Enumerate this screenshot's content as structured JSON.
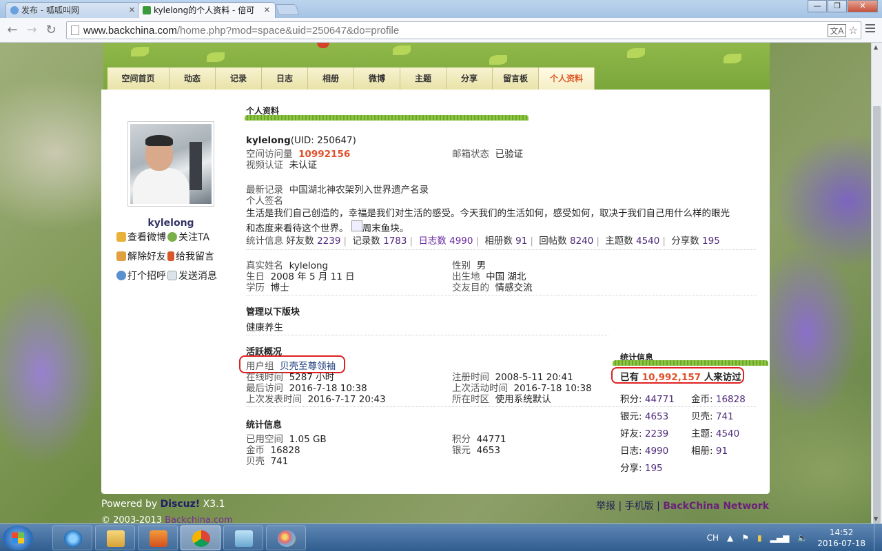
{
  "browser": {
    "tabs": [
      {
        "title": "发布 - 呱呱叫网"
      },
      {
        "title": "kylelong的个人资料 - 倍可"
      }
    ],
    "url_host": "www.backchina.com",
    "url_path": "/home.php?mod=space&uid=250647&do=profile",
    "window_buttons": {
      "minimize": "—",
      "restore": "❐",
      "close": "✕"
    }
  },
  "nav": {
    "items": [
      "空间首页",
      "动态",
      "记录",
      "日志",
      "相册",
      "微博",
      "主题",
      "分享",
      "留言板",
      "个人资料"
    ],
    "current_index": 9
  },
  "sidebar": {
    "username": "kylelong",
    "actions": [
      "查看微博",
      "关注TA",
      "解除好友",
      "给我留言",
      "打个招呼",
      "发送消息"
    ]
  },
  "profile": {
    "section_title": "个人资料",
    "name": "kylelong",
    "uid": "(UID: 250647)",
    "visits_label": "空间访问量",
    "visits_value": "10992156",
    "email_label": "邮箱状态",
    "email_value": "已验证",
    "video_label": "视频认证",
    "video_value": "未认证",
    "latest_label": "最新记录",
    "latest_value": "中国湖北神农架列入世界遗产名录",
    "sign_label": "个人签名",
    "signature_line1": "生活是我们自己创造的，幸福是我们对生活的感受。今天我们的生活如何，感受如何，取决于我们自己用什么样的眼光",
    "signature_line2": "和态度来看待这个世界。",
    "signature_img": "周末鱼块。",
    "stats_label": "统计信息",
    "stats": [
      {
        "label": "好友数",
        "value": "2239"
      },
      {
        "label": "记录数",
        "value": "1783"
      },
      {
        "label": "日志数",
        "value": "4990"
      },
      {
        "label": "相册数",
        "value": "91"
      },
      {
        "label": "回帖数",
        "value": "8240"
      },
      {
        "label": "主题数",
        "value": "4540"
      },
      {
        "label": "分享数",
        "value": "195"
      }
    ],
    "realname_label": "真实姓名",
    "realname_value": "kylelong",
    "gender_label": "性别",
    "gender_value": "男",
    "birthday_label": "生日",
    "birthday_value": "2008 年 5 月 11 日",
    "birthplace_label": "出生地",
    "birthplace_value": "中国 湖北",
    "edu_label": "学历",
    "edu_value": "博士",
    "purpose_label": "交友目的",
    "purpose_value": "情感交流"
  },
  "manage": {
    "title": "管理以下版块",
    "forum": "健康养生"
  },
  "activity": {
    "title": "活跃概况",
    "group_label": "用户组",
    "group_value": "贝壳至尊领袖",
    "online_label": "在线时间",
    "online_value": "5287 小时",
    "register_label": "注册时间",
    "register_value": "2008-5-11 20:41",
    "lastvisit_label": "最后访问",
    "lastvisit_value": "2016-7-18 10:38",
    "lastactive_label": "上次活动时间",
    "lastactive_value": "2016-7-18 10:38",
    "lastpost_label": "上次发表时间",
    "lastpost_value": "2016-7-17 20:43",
    "tz_label": "所在时区",
    "tz_value": "使用系统默认"
  },
  "stats_block": {
    "title": "统计信息",
    "used_label": "已用空间",
    "used_value": "1.05 GB",
    "points_label": "积分",
    "points_value": "44771",
    "gold_label": "金币",
    "gold_value": "16828",
    "silver_label": "银元",
    "silver_value": "4653",
    "shell_label": "贝壳",
    "shell_value": "741"
  },
  "right_stats": {
    "title": "统计信息",
    "visitors_prefix": "已有",
    "visitors_count": "10,992,157",
    "visitors_suffix": "人来访过",
    "items": [
      {
        "label": "积分:",
        "value": "44771"
      },
      {
        "label": "金币:",
        "value": "16828"
      },
      {
        "label": "银元:",
        "value": "4653"
      },
      {
        "label": "贝壳:",
        "value": "741"
      },
      {
        "label": "好友:",
        "value": "2239"
      },
      {
        "label": "主题:",
        "value": "4540"
      },
      {
        "label": "日志:",
        "value": "4990"
      },
      {
        "label": "相册:",
        "value": "91"
      },
      {
        "label": "分享:",
        "value": "195"
      }
    ]
  },
  "footer": {
    "powered": "Powered by",
    "brand": "Discuz!",
    "version": "X3.1",
    "copyright": "© 2003-2013",
    "copyright_site": "Backchina.com",
    "report": "举报",
    "mobile": "手机版",
    "network": "BackChina Network"
  },
  "taskbar": {
    "ime": "CH",
    "time": "14:52",
    "date": "2016-07-18"
  },
  "colors": {
    "accent_red": "#e0502a",
    "link_purple": "#4e2a7a",
    "annotation_red": "#e02020"
  }
}
